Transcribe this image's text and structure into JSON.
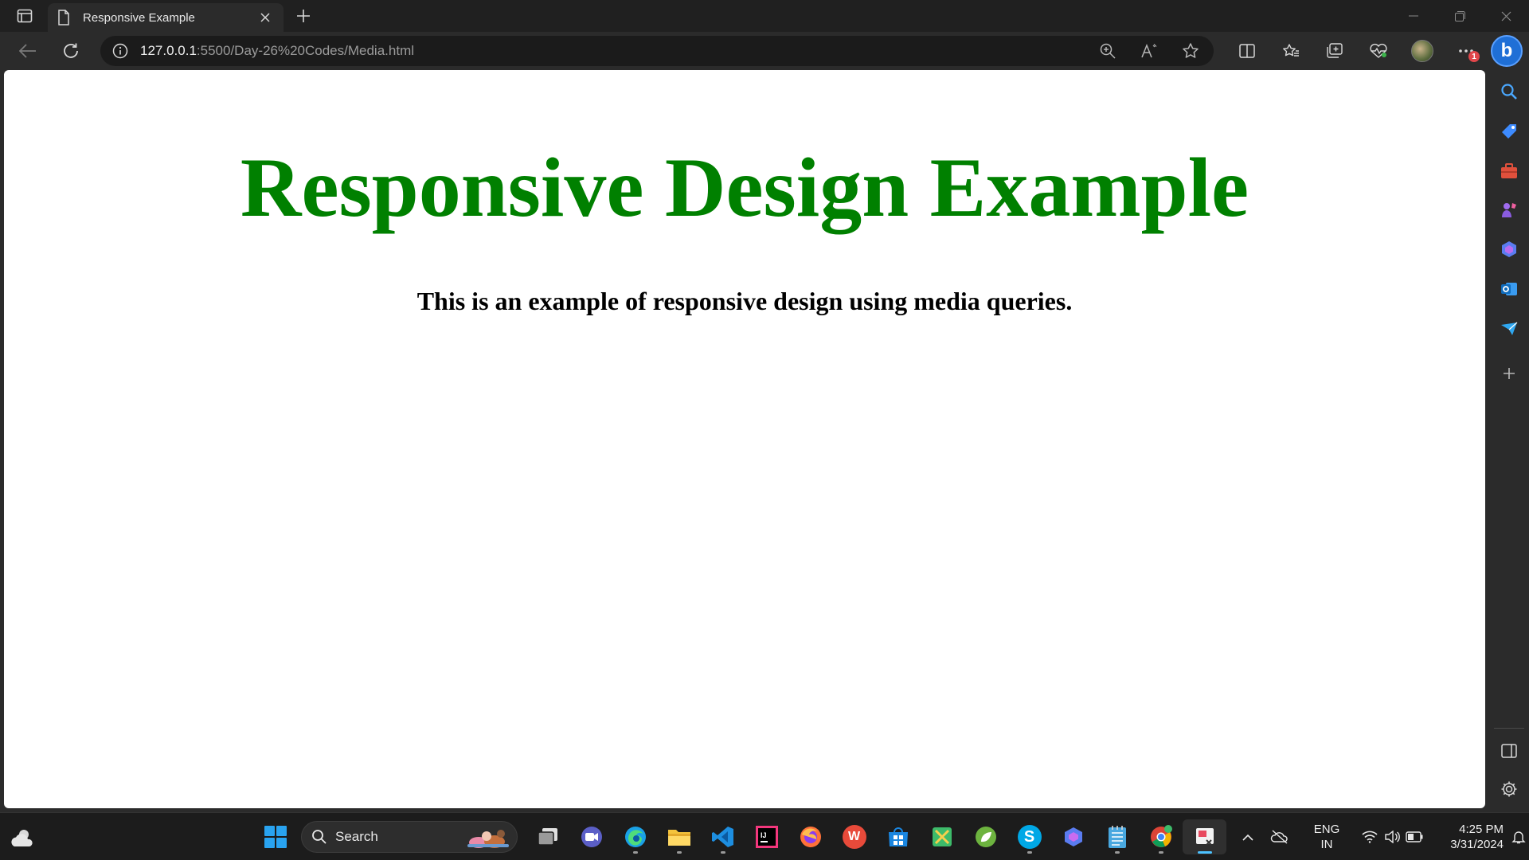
{
  "browser": {
    "tab": {
      "title": "Responsive Example"
    },
    "address": {
      "host": "127.0.0.1",
      "rest": ":5500/Day-26%20Codes/Media.html"
    },
    "notification_badge": "1"
  },
  "page": {
    "heading": "Responsive Design Example",
    "text": "This is an example of responsive design using media queries.",
    "heading_color": "#008000"
  },
  "taskbar": {
    "search_label": "Search",
    "language": {
      "line1": "ENG",
      "line2": "IN"
    },
    "clock": {
      "time": "4:25 PM",
      "date": "3/31/2024"
    }
  },
  "colors": {
    "accent": "#4cc2ff",
    "start": "#29a3f0",
    "bing": "#1f6fd6"
  }
}
